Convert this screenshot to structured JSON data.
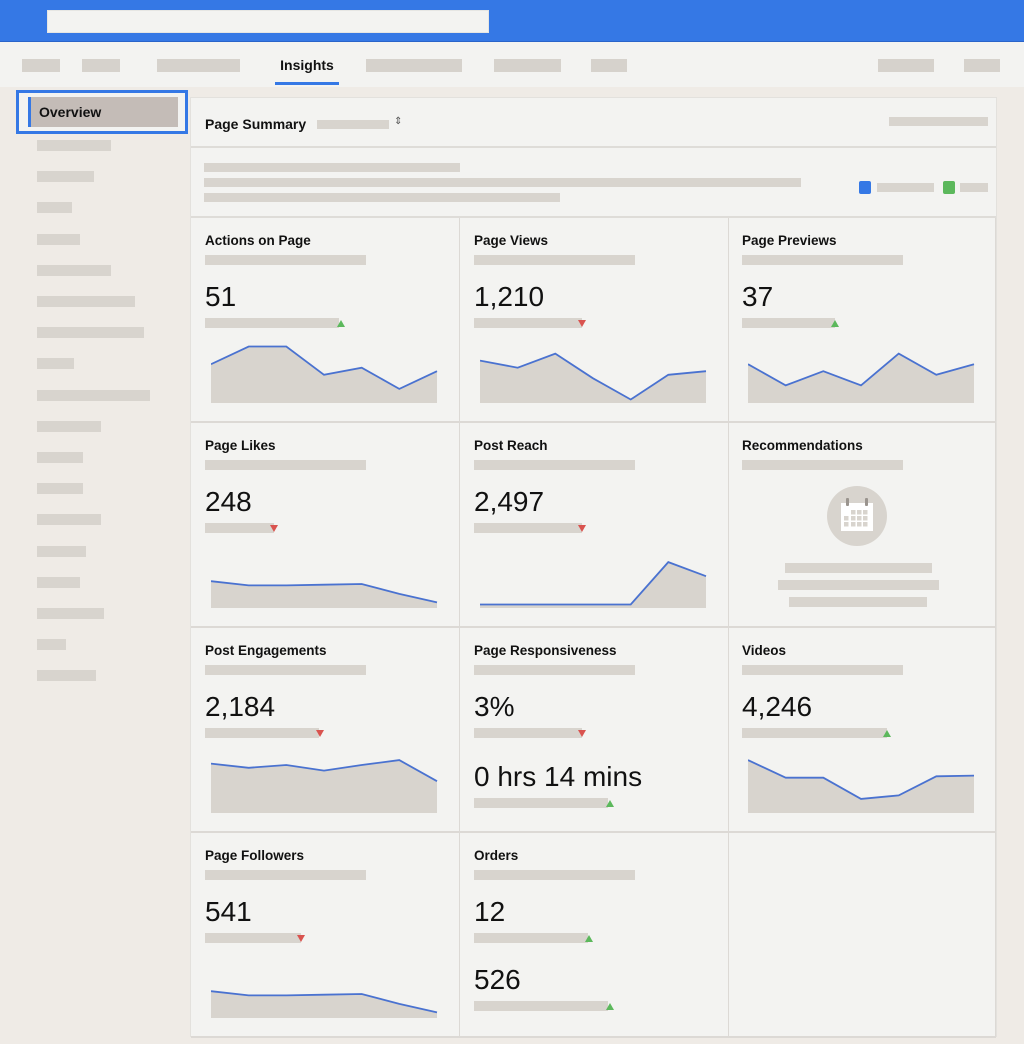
{
  "header": {
    "search_placeholder": ""
  },
  "tabs": {
    "active_label": "Insights"
  },
  "sidebar": {
    "active_label": "Overview",
    "placeholder_count": 18
  },
  "summary": {
    "title": "Page Summary",
    "caret": "⇕",
    "legend_colors": [
      "#3578e5",
      "#5cb85c"
    ]
  },
  "colors": {
    "accent": "#3578e5",
    "up": "#5cb85c",
    "down": "#d9534f",
    "sparkline": "#4a72d0",
    "spark_fill": "#d8d4ce"
  },
  "cards": [
    {
      "title": "Actions on Page",
      "value": "51",
      "trend": "up",
      "spark": [
        55,
        80,
        80,
        40,
        50,
        20,
        45
      ]
    },
    {
      "title": "Page Views",
      "value": "1,210",
      "trend": "down",
      "spark": [
        60,
        50,
        70,
        35,
        5,
        40,
        45
      ]
    },
    {
      "title": "Page Previews",
      "value": "37",
      "trend": "up",
      "spark": [
        55,
        25,
        45,
        25,
        70,
        40,
        55
      ]
    },
    {
      "title": "Page Likes",
      "value": "248",
      "trend": "down",
      "spark": [
        38,
        32,
        32,
        33,
        34,
        20,
        8
      ]
    },
    {
      "title": "Post Reach",
      "value": "2,497",
      "trend": "down",
      "spark": [
        5,
        5,
        5,
        5,
        5,
        65,
        45
      ]
    },
    {
      "title": "Recommendations",
      "type": "recommendation"
    },
    {
      "title": "Post Engagements",
      "value": "2,184",
      "trend": "down",
      "spark": [
        70,
        64,
        68,
        60,
        68,
        75,
        45
      ]
    },
    {
      "title": "Page Responsiveness",
      "type": "dual",
      "value": "3%",
      "trend": "down",
      "value2": "0 hrs 14 mins",
      "trend2": "up"
    },
    {
      "title": "Videos",
      "value": "4,246",
      "trend": "up",
      "spark": [
        75,
        50,
        50,
        20,
        25,
        52,
        53
      ]
    },
    {
      "title": "Page Followers",
      "value": "541",
      "trend": "down",
      "spark": [
        38,
        32,
        32,
        33,
        34,
        20,
        8
      ]
    },
    {
      "title": "Orders",
      "type": "dual",
      "value": "12",
      "trend": "up",
      "value2": "526",
      "trend2": "up"
    },
    {
      "type": "empty"
    }
  ]
}
